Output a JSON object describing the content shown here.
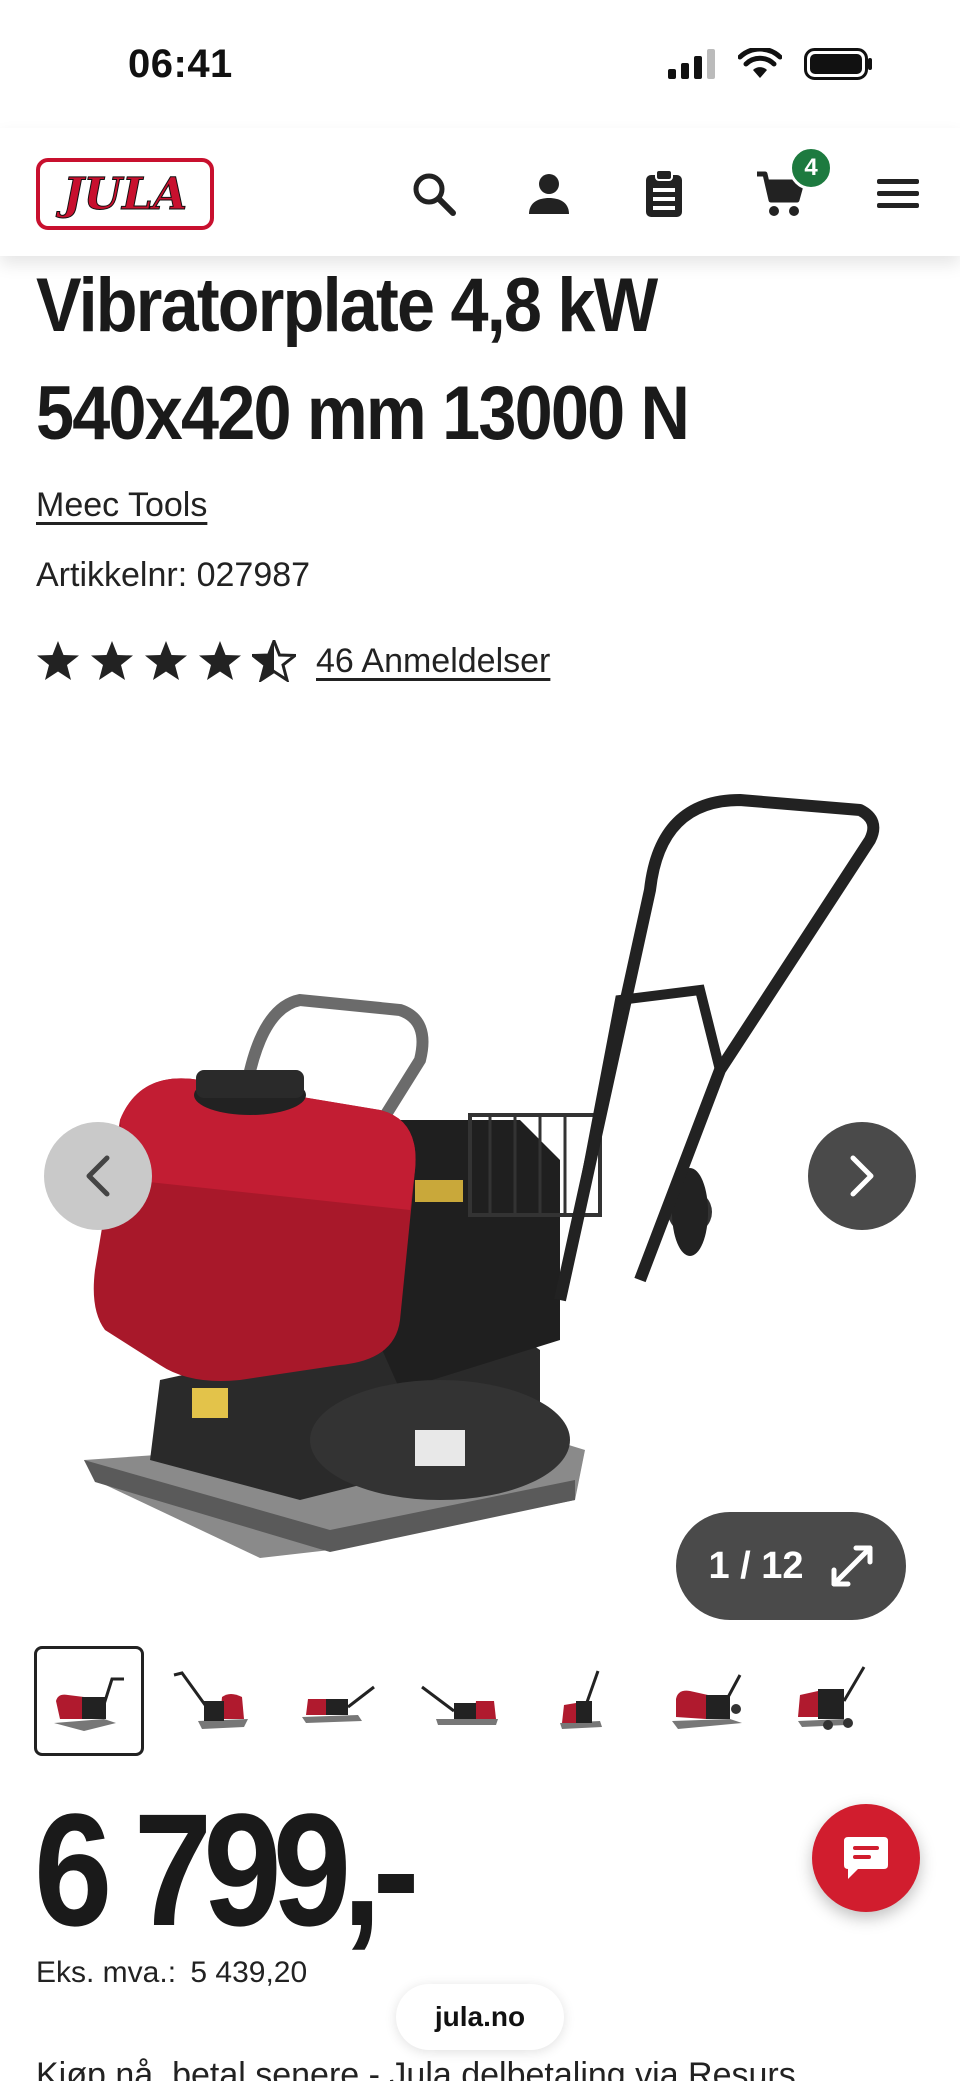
{
  "status_bar": {
    "time": "06:41"
  },
  "header": {
    "logo_text": "JULA",
    "cart_count": "4",
    "icons": [
      "search-icon",
      "account-icon",
      "clipboard-icon",
      "cart-icon",
      "menu-icon"
    ]
  },
  "product": {
    "title": "Vibratorplate 4,8 kW 540x420 mm 13000 N",
    "brand": "Meec Tools",
    "article_number": "Artikkelnr: 027987",
    "rating": {
      "stars": 4.5,
      "max": 5
    },
    "reviews_link": "46 Anmeldelser"
  },
  "gallery": {
    "counter": "1 / 12",
    "current": 1,
    "total": 12,
    "thumbnail_count": 7
  },
  "pricing": {
    "price": "6 799,-",
    "ex_vat_label": "Eks. mva.:",
    "ex_vat_value": "5 439,20"
  },
  "footer": {
    "domain": "jula.no",
    "promo_text": "Kjøp nå, betal senere - Jula delbetaling via Resurs"
  },
  "colors": {
    "brand_red": "#c8102e",
    "badge_green": "#1d7a3f",
    "chat_red": "#d11d2e",
    "dark_button": "#4a4a4a"
  }
}
